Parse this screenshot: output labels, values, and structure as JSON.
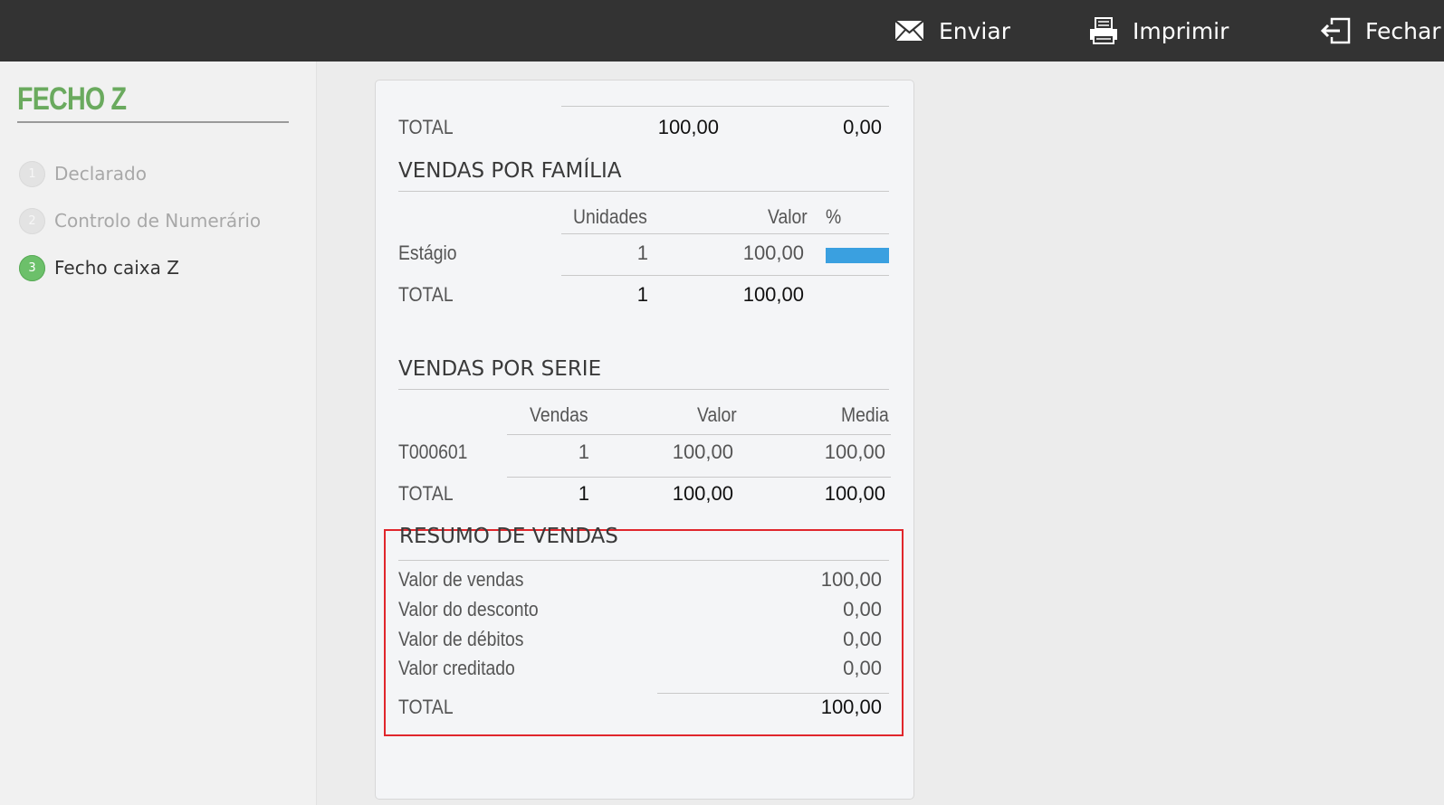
{
  "toolbar": {
    "send_label": "Enviar",
    "print_label": "Imprimir",
    "close_label": "Fechar"
  },
  "sidebar": {
    "title": "FECHO Z",
    "steps": [
      {
        "number": "1",
        "label": "Declarado",
        "state": "inactive"
      },
      {
        "number": "2",
        "label": "Controlo de Numerário",
        "state": "inactive"
      },
      {
        "number": "3",
        "label": "Fecho caixa Z",
        "state": "active"
      }
    ]
  },
  "report": {
    "top_total": {
      "label": "TOTAL",
      "value1": "100,00",
      "value2": "0,00"
    },
    "familia": {
      "title": "VENDAS POR FAMÍLIA",
      "headers": [
        "Unidades",
        "Valor",
        "%"
      ],
      "rows": [
        {
          "name": "Estágio",
          "unidades": "1",
          "valor": "100,00",
          "percent": 1.0
        }
      ],
      "total": {
        "label": "TOTAL",
        "unidades": "1",
        "valor": "100,00"
      }
    },
    "serie": {
      "title": "VENDAS POR SERIE",
      "headers": [
        "Vendas",
        "Valor",
        "Media"
      ],
      "rows": [
        {
          "name": "T000601",
          "vendas": "1",
          "valor": "100,00",
          "media": "100,00"
        }
      ],
      "total": {
        "label": "TOTAL",
        "vendas": "1",
        "valor": "100,00",
        "media": "100,00"
      }
    },
    "resumo": {
      "title": "RESUMO DE VENDAS",
      "rows": [
        {
          "label": "Valor de vendas",
          "value": "100,00"
        },
        {
          "label": "Valor do desconto",
          "value": "0,00"
        },
        {
          "label": "Valor de débitos",
          "value": "0,00"
        },
        {
          "label": "Valor creditado",
          "value": "0,00"
        }
      ],
      "total": {
        "label": "TOTAL",
        "value": "100,00"
      }
    }
  },
  "colors": {
    "topbar": "#333333",
    "title_green": "#6aaa5e",
    "active_step": "#6cc06a",
    "percent_bar": "#3aa0e0",
    "highlight_border": "#e0262c"
  },
  "icons": [
    "envelope-icon",
    "printer-icon",
    "exit-icon"
  ]
}
